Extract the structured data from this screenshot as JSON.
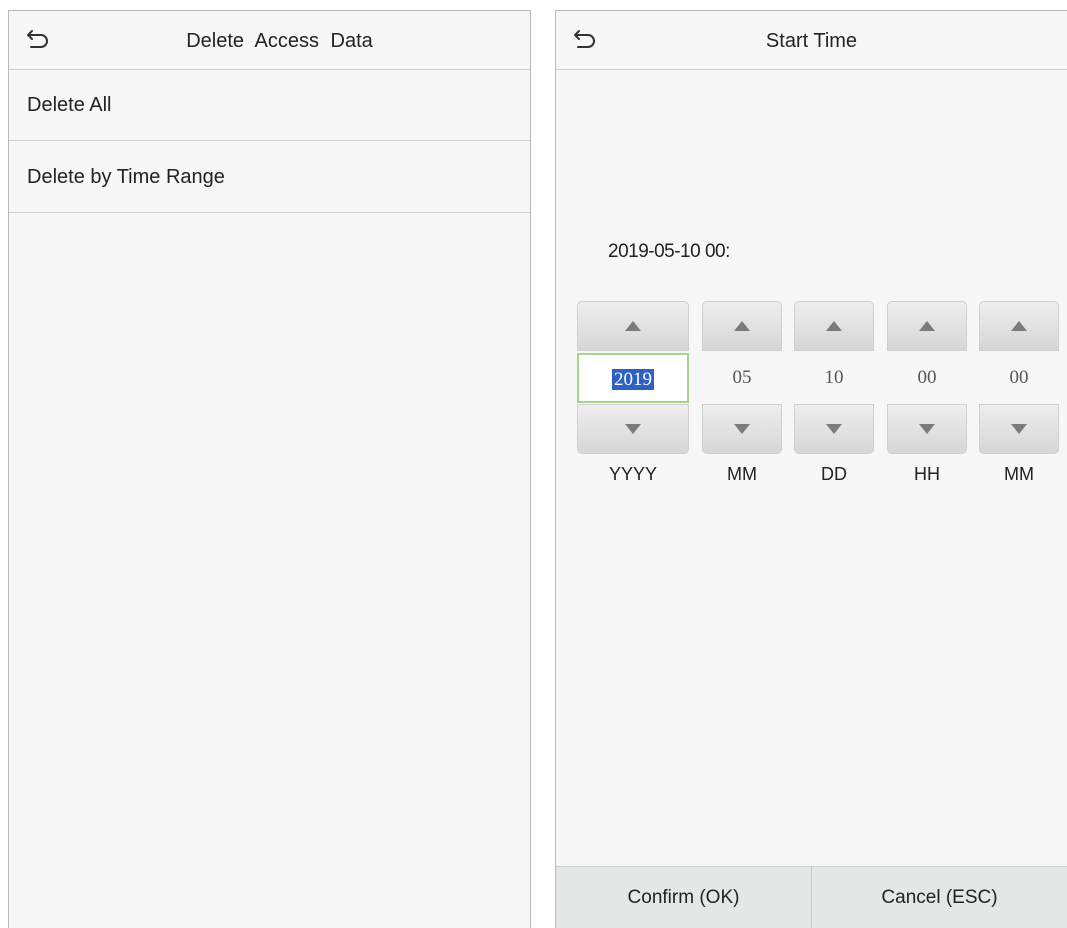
{
  "left_screen": {
    "title": "Delete Access Data",
    "menu": [
      {
        "label": "Delete All"
      },
      {
        "label": "Delete by Time Range"
      }
    ]
  },
  "right_screen": {
    "title": "Start Time",
    "date_display": "2019-05-10 00:",
    "fields": [
      {
        "value": "2019",
        "unit": "YYYY",
        "selected": true
      },
      {
        "value": "05",
        "unit": "MM"
      },
      {
        "value": "10",
        "unit": "DD"
      },
      {
        "value": "00",
        "unit": "HH"
      },
      {
        "value": "00",
        "unit": "MM"
      }
    ],
    "confirm_label": "Confirm (OK)",
    "cancel_label": "Cancel (ESC)"
  },
  "colors": {
    "selection": "#2d62c4",
    "focus_border": "#a6d48a",
    "footer_bg": "#e3e8e6"
  },
  "icons": {
    "back": "back-arrow-icon",
    "increment": "triangle-up-icon",
    "decrement": "triangle-down-icon"
  }
}
